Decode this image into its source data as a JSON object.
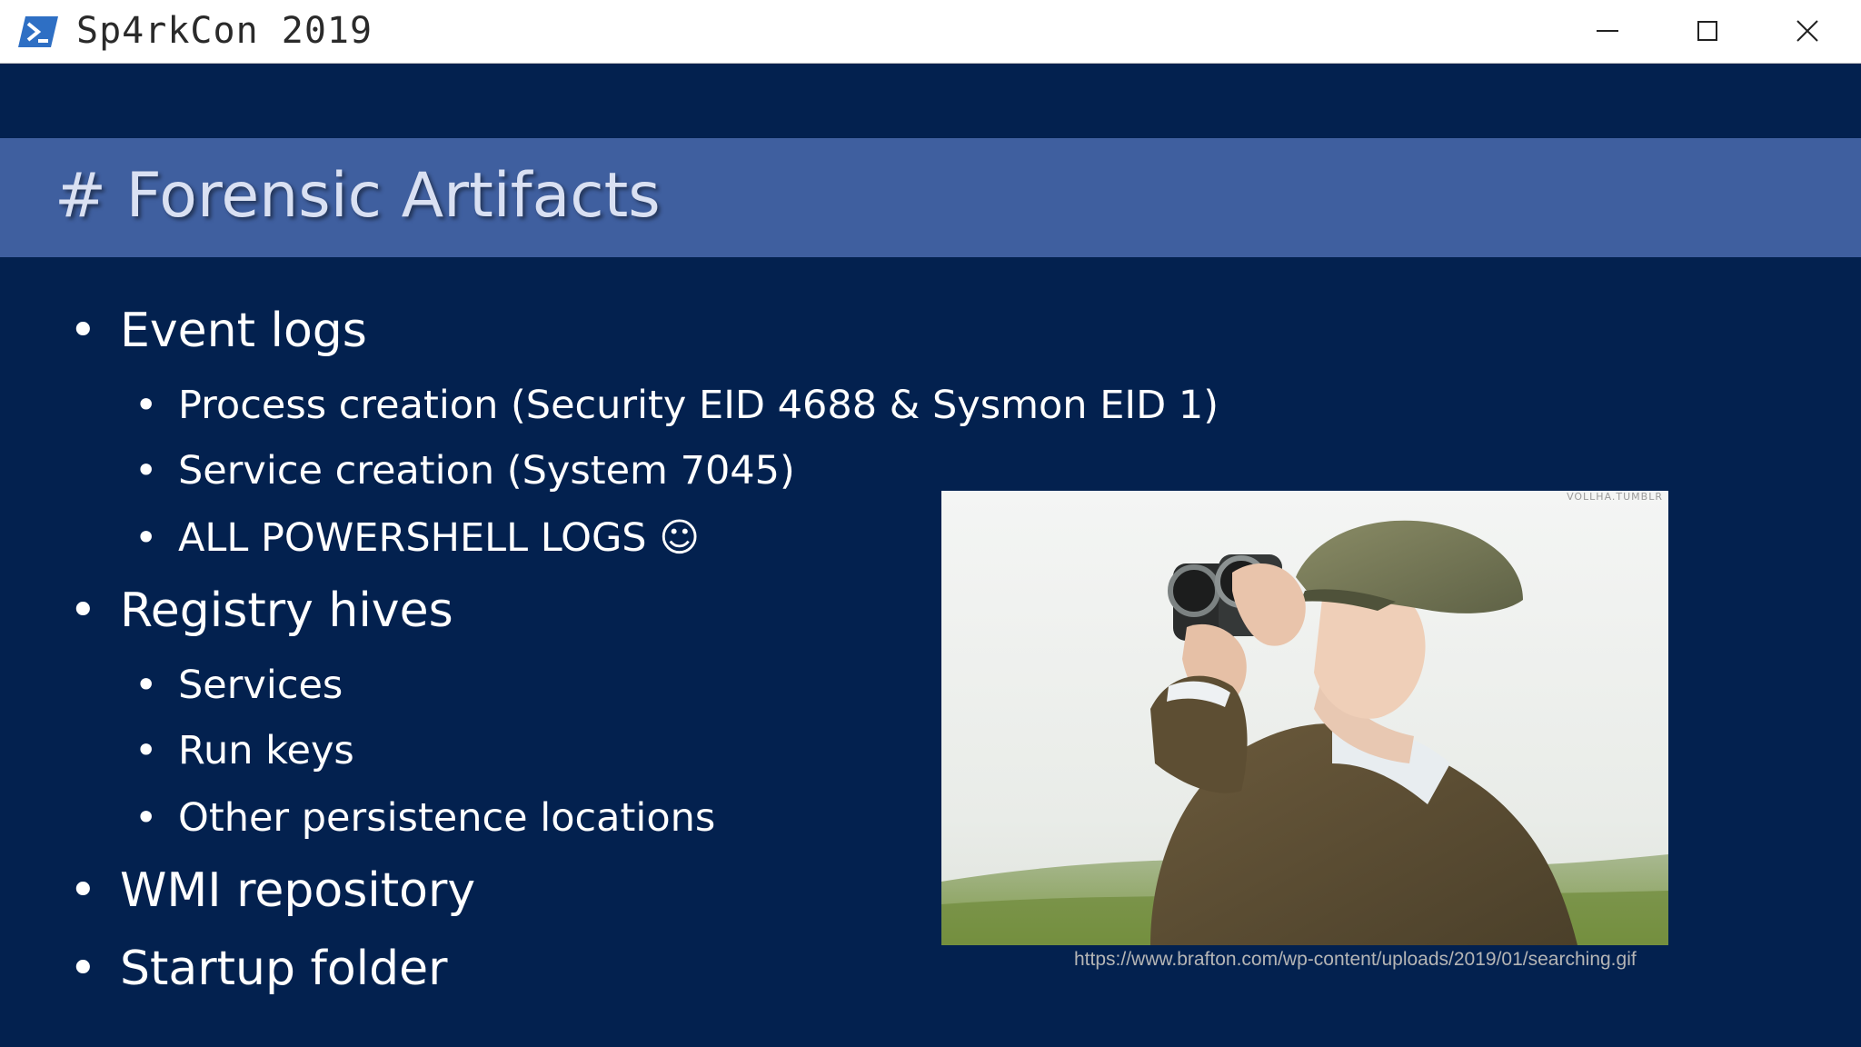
{
  "window": {
    "title": "Sp4rkCon 2019",
    "controls": {
      "minimize_icon": "minimize-icon",
      "maximize_icon": "maximize-icon",
      "close_icon": "close-icon"
    },
    "app_icon": "powershell-icon"
  },
  "slide": {
    "title": "# Forensic Artifacts",
    "bullets": [
      {
        "label": "Event logs",
        "children": [
          "Process creation (Security EID 4688 & Sysmon EID 1)",
          "Service creation (System 7045)",
          "ALL POWERSHELL LOGS ☺"
        ]
      },
      {
        "label": "Registry hives",
        "children": [
          "Services",
          "Run keys",
          "Other persistence locations"
        ]
      },
      {
        "label": "WMI repository",
        "children": []
      },
      {
        "label": "Startup folder",
        "children": []
      }
    ],
    "image": {
      "watermark": "VOLLHA.TUMBLR"
    },
    "source_url": "https://www.brafton.com/wp-content/uploads/2019/01/searching.gif"
  },
  "colors": {
    "slide_background": "#03214f",
    "title_band": "#3f5f9f",
    "title_text": "#d9e0f2",
    "bullet_text": "#ffffff"
  }
}
